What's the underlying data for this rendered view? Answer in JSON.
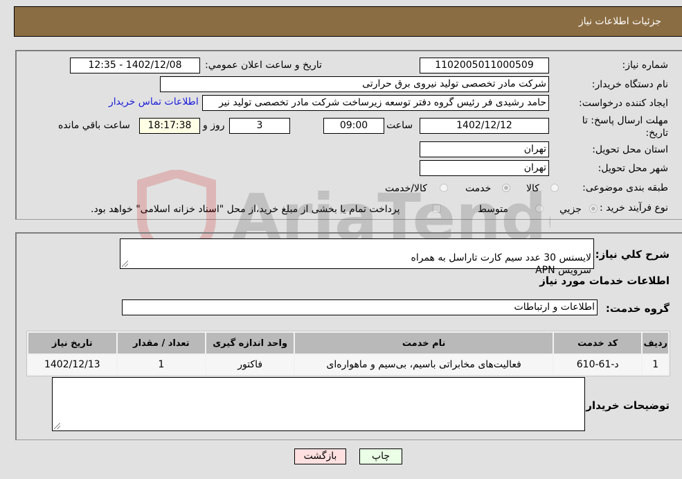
{
  "header": {
    "title": "جزئيات اطلاعات نياز"
  },
  "need_info": {
    "need_number_label": "شماره نياز:",
    "need_number": "1102005011000509",
    "announce_label": "تاريخ و ساعت اعلان عمومي:",
    "announce_value": "1402/12/08 - 12:35",
    "buyer_org_label": "نام دستگاه خريدار:",
    "buyer_org": "شرکت مادر تخصصی تولید نیروی برق حرارتی",
    "requester_label": "ايجاد کننده درخواست:",
    "requester": "حامد رشیدی فر رئیس گروه دفتر توسعه زیرساخت شرکت مادر تخصصی تولید نیر",
    "contact_link": "اطلاعات تماس خريدار",
    "deadline_label": "مهلت ارسال پاسخ: تا تاريخ:",
    "deadline_date": "1402/12/12",
    "time_label": "ساعت",
    "deadline_time": "09:00",
    "days_value": "3",
    "days_label": "روز و",
    "remaining_time": "18:17:38",
    "remaining_label": "ساعت باقي مانده",
    "province_label": "استان محل تحويل:",
    "province": "تهران",
    "city_label": "شهر محل تحويل:",
    "city": "تهران",
    "category_label": "طبقه بندی موضوعی:",
    "category_options": [
      {
        "label": "کالا",
        "selected": false
      },
      {
        "label": "خدمت",
        "selected": true
      },
      {
        "label": "کالا/خدمت",
        "selected": false
      }
    ],
    "process_label": "نوع فرآيند خريد :",
    "process_options": [
      {
        "label": "جزيي",
        "selected": true
      },
      {
        "label": "متوسط",
        "selected": false
      }
    ],
    "payment_note": "پرداخت تمام يا بخشی از مبلغ خريد،از محل \"اسناد خزانه اسلامی\" خواهد بود.",
    "payment_checked": false
  },
  "description": {
    "label": "شرح کلي نياز:",
    "text": "لایسنس 30 عدد سیم کارت تاراسل به همراه\nسرویس APN"
  },
  "services": {
    "section_title": "اطلاعات خدمات مورد نياز",
    "group_label": "گروه خدمت:",
    "group_value": "اطلاعات و ارتباطات",
    "table": {
      "headers": [
        "رديف",
        "کد خدمت",
        "نام خدمت",
        "واحد اندازه گيری",
        "تعداد / مقدار",
        "تاريخ نياز"
      ],
      "rows": [
        [
          "1",
          "د-61-610",
          "فعالیت‌های مخابراتی باسیم، بی‌سیم و ماهواره‌ای",
          "فاکتور",
          "1",
          "1402/12/13"
        ]
      ]
    }
  },
  "buyer_notes": {
    "label": "توضيحات خريدار:",
    "value": ""
  },
  "buttons": {
    "print": "چاپ",
    "back": "بازگشت"
  },
  "watermark": {
    "text": "AriaTender.neT"
  }
}
